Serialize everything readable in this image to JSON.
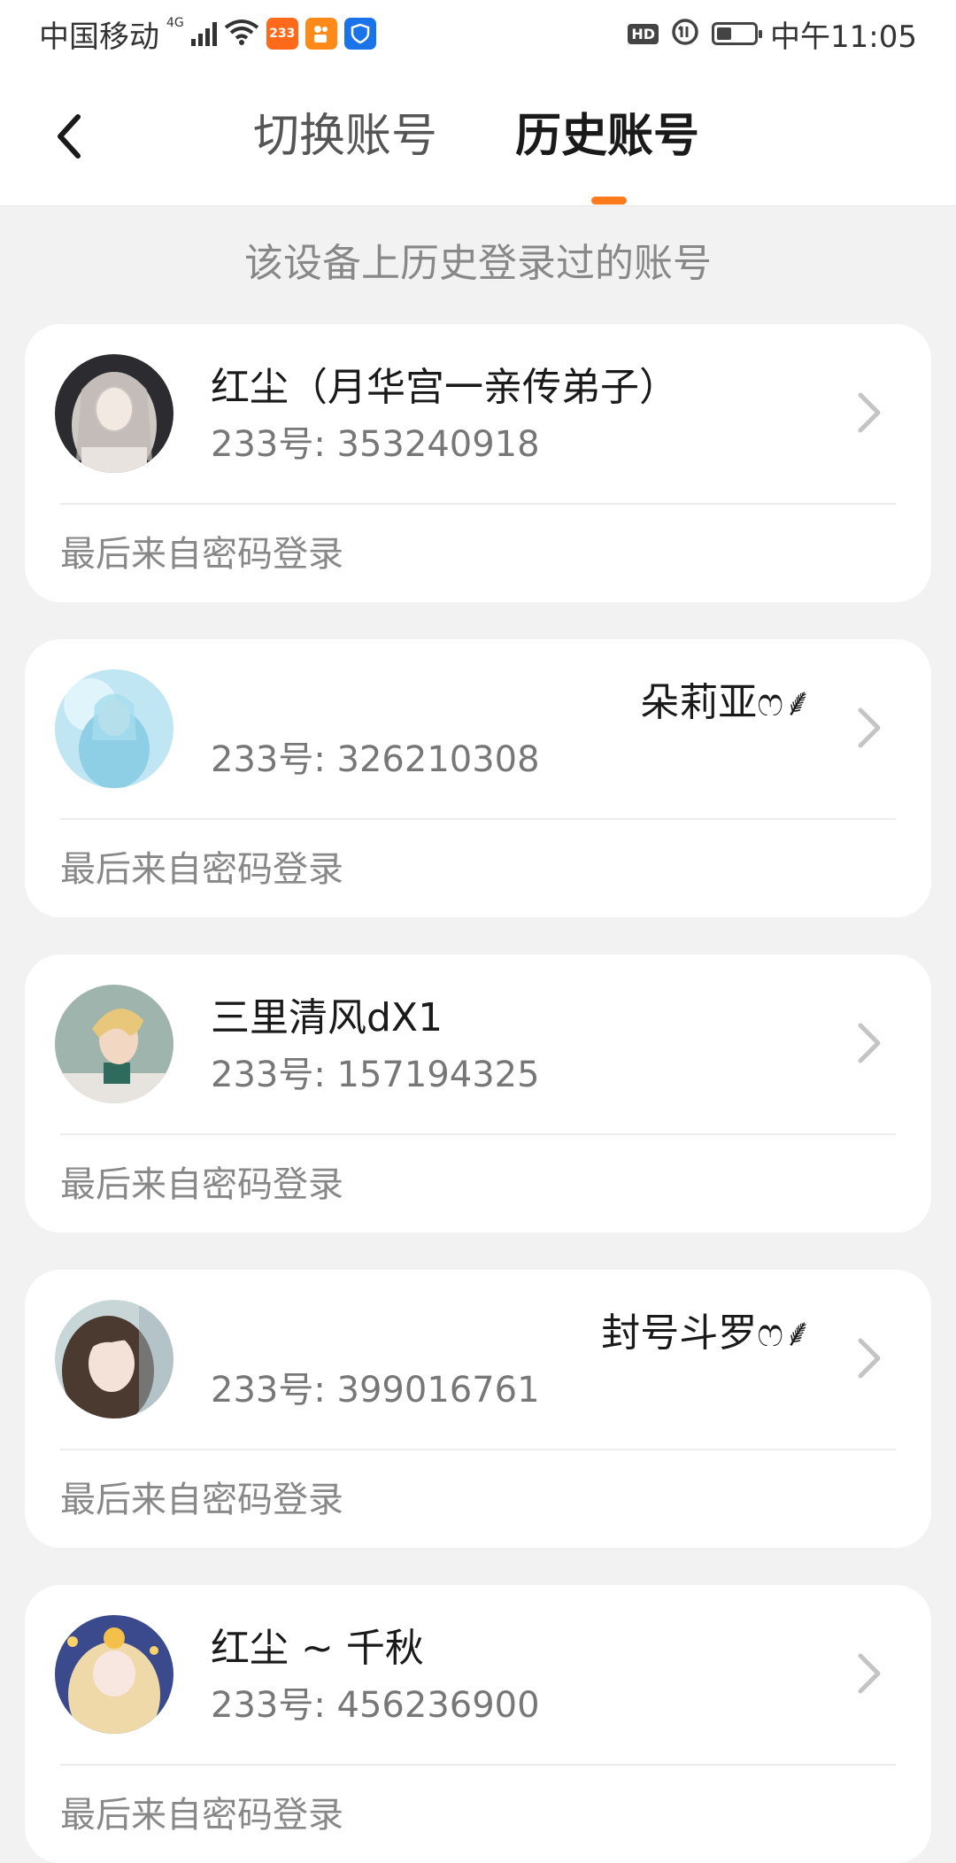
{
  "status_bar": {
    "carrier": "中国移动",
    "network": "4G",
    "app_badge_1": "233",
    "time": "中午11:05",
    "hd": "HD",
    "battery_level": 0.4
  },
  "header": {
    "back_icon": "chevron-left-icon",
    "tabs": [
      {
        "label": "切换账号",
        "active": false
      },
      {
        "label": "历史账号",
        "active": true
      }
    ],
    "accent_color": "#ff7a1a"
  },
  "subtitle": "该设备上历史登录过的账号",
  "accounts": [
    {
      "name": "红尘（月华宫一亲传弟子）",
      "id_text": "233号: 353240918",
      "login_source": "最后来自密码登录"
    },
    {
      "name": "朵莉亚ෆ⸙",
      "id_text": "233号: 326210308",
      "login_source": "最后来自密码登录"
    },
    {
      "name": "三里清风dX1",
      "id_text": "233号: 157194325",
      "login_source": "最后来自密码登录"
    },
    {
      "name": "封号斗罗ෆ⸙",
      "id_text": "233号: 399016761",
      "login_source": "最后来自密码登录"
    },
    {
      "name": "红尘 ~ 千秋",
      "id_text": "233号: 456236900",
      "login_source": "最后来自密码登录"
    }
  ]
}
